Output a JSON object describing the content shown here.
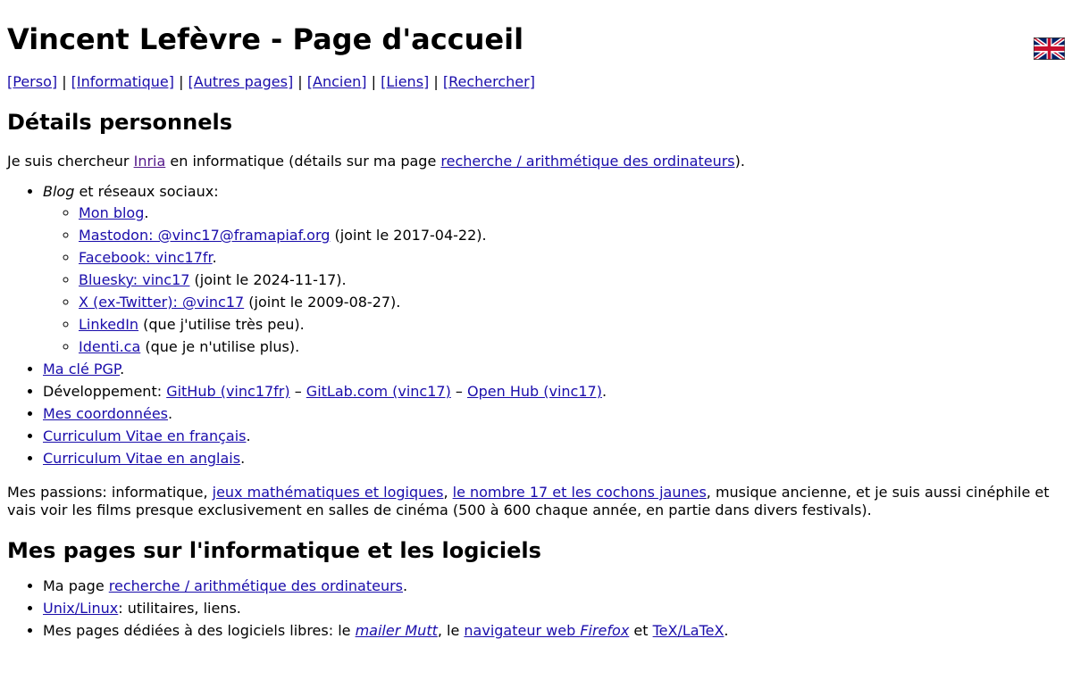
{
  "header": {
    "title": "Vincent Lefèvre - Page d'accueil",
    "flag_alt": "English version"
  },
  "nav": {
    "items": [
      "[Perso]",
      "[Informatique]",
      "[Autres pages]",
      "[Ancien]",
      "[Liens]",
      "[Rechercher]"
    ],
    "separator": " | "
  },
  "section1": {
    "heading": "Détails personnels",
    "intro": {
      "t1": "Je suis chercheur ",
      "inria": "Inria",
      "t2": " en informatique (détails sur ma page ",
      "research_link": "recherche / arithmétique des ordinateurs",
      "t3": ")."
    },
    "blog": {
      "label_em": "Blog",
      "label_rest": " et réseaux sociaux:",
      "sub": [
        {
          "link": "Mon blog",
          "rest": "."
        },
        {
          "link": "Mastodon: @vinc17@framapiaf.org",
          "rest": " (joint le 2017-04-22)."
        },
        {
          "link": "Facebook: vinc17fr",
          "rest": "."
        },
        {
          "link": "Bluesky: vinc17",
          "rest": " (joint le 2024-11-17)."
        },
        {
          "link": "X (ex-Twitter): @vinc17",
          "rest": " (joint le 2009-08-27)."
        },
        {
          "link": "LinkedIn",
          "rest": " (que j'utilise très peu)."
        },
        {
          "link": "Identi.ca",
          "rest": " (que je n'utilise plus)."
        }
      ]
    },
    "pgp": {
      "link": "Ma clé PGP",
      "rest": "."
    },
    "dev": {
      "label": "Développement: ",
      "github": "GitHub (vinc17fr)",
      "dash": " – ",
      "gitlab": "GitLab.com (vinc17)",
      "openhub": "Open Hub (vinc17)",
      "rest": "."
    },
    "coords": {
      "link": "Mes coordonnées",
      "rest": "."
    },
    "cv_fr": {
      "link": "Curriculum Vitae en français",
      "rest": "."
    },
    "cv_en": {
      "link": "Curriculum Vitae en anglais",
      "rest": "."
    },
    "passions": {
      "t1": "Mes passions: informatique, ",
      "games": "jeux mathématiques et logiques",
      "t2": ", ",
      "n17": "le nombre 17 et les cochons jaunes",
      "t3": ", musique ancienne, et je suis aussi cinéphile et vais voir les films presque exclusivement en salles de cinéma (500 à 600 chaque année, en partie dans divers festivals)."
    }
  },
  "section2": {
    "heading": "Mes pages sur l'informatique et les logiciels",
    "research": {
      "t1": "Ma page ",
      "link": "recherche / arithmétique des ordinateurs",
      "rest": "."
    },
    "unix": {
      "link": "Unix/Linux",
      "rest": ": utilitaires, liens."
    },
    "free": {
      "t1": "Mes pages dédiées à des logiciels libres: le ",
      "mutt_em": "mailer Mutt",
      "t2": ", le ",
      "firefox_a": "navigateur web ",
      "firefox_em": "Firefox",
      "t3": " et ",
      "tex": "TeX/LaTeX",
      "rest": "."
    }
  },
  "colors": {
    "link": "#1a0dab",
    "visited": "#551a8b",
    "text": "#000000",
    "background": "#ffffff"
  }
}
